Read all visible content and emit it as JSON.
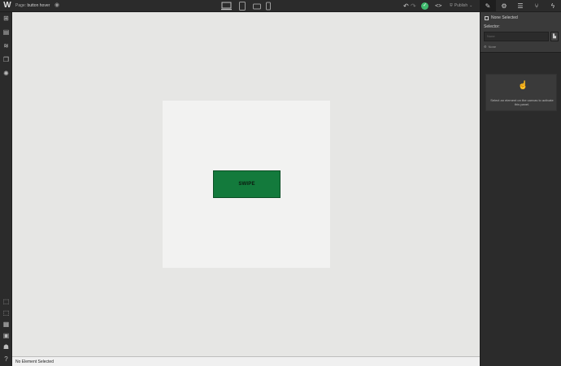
{
  "topbar": {
    "logo": "W",
    "page_label_prefix": "Page:",
    "page_name": "button hover",
    "publish_label": "Publish"
  },
  "canvas": {
    "button_label": "SWIPE"
  },
  "statusbar": {
    "text": "No Element Selected"
  },
  "panel": {
    "none_selected": "None Selected",
    "selector_label": "Selector:",
    "selector_placeholder": "None",
    "none_item": "None",
    "empty_message": "Select an element on the canvas to activate this panel."
  },
  "colors": {
    "button_bg": "#137a3c",
    "status_ok": "#3fb96d"
  }
}
